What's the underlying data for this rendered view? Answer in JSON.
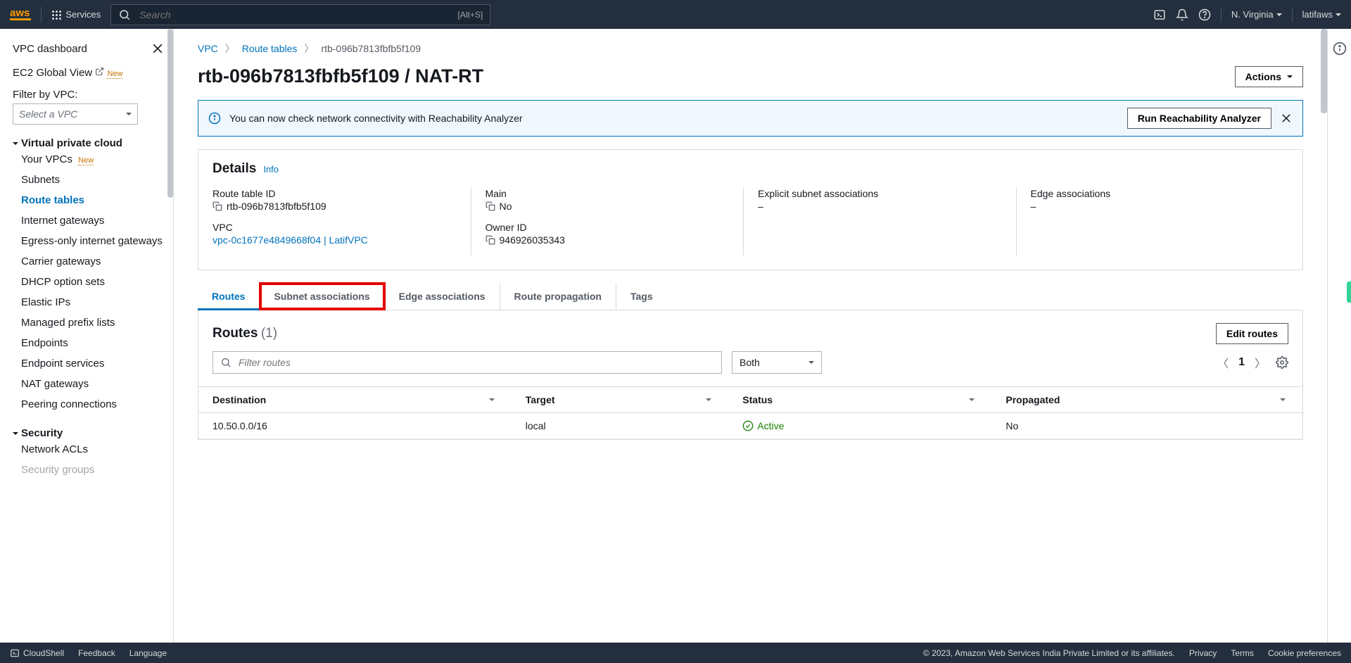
{
  "header": {
    "services": "Services",
    "search_placeholder": "Search",
    "search_shortcut": "[Alt+S]",
    "region": "N. Virginia",
    "user": "latifaws"
  },
  "sidebar": {
    "dashboard": "VPC dashboard",
    "ec2_global": "EC2 Global View",
    "new_badge": "New",
    "filter_label": "Filter by VPC:",
    "select_placeholder": "Select a VPC",
    "sections": [
      {
        "title": "Virtual private cloud",
        "items": [
          {
            "label": "Your VPCs",
            "new": true,
            "active": false
          },
          {
            "label": "Subnets"
          },
          {
            "label": "Route tables",
            "active": true
          },
          {
            "label": "Internet gateways"
          },
          {
            "label": "Egress-only internet gateways"
          },
          {
            "label": "Carrier gateways"
          },
          {
            "label": "DHCP option sets"
          },
          {
            "label": "Elastic IPs"
          },
          {
            "label": "Managed prefix lists"
          },
          {
            "label": "Endpoints"
          },
          {
            "label": "Endpoint services"
          },
          {
            "label": "NAT gateways"
          },
          {
            "label": "Peering connections"
          }
        ]
      },
      {
        "title": "Security",
        "items": [
          {
            "label": "Network ACLs"
          },
          {
            "label": "Security groups"
          }
        ]
      }
    ]
  },
  "breadcrumbs": {
    "vpc": "VPC",
    "route_tables": "Route tables",
    "current": "rtb-096b7813fbfb5f109"
  },
  "page_title": "rtb-096b7813fbfb5f109 / NAT-RT",
  "actions_label": "Actions",
  "banner": {
    "text": "You can now check network connectivity with Reachability Analyzer",
    "button": "Run Reachability Analyzer"
  },
  "details": {
    "title": "Details",
    "info": "Info",
    "route_table_id": {
      "label": "Route table ID",
      "value": "rtb-096b7813fbfb5f109"
    },
    "main": {
      "label": "Main",
      "value": "No"
    },
    "explicit_subnet": {
      "label": "Explicit subnet associations",
      "value": "–"
    },
    "edge_assoc": {
      "label": "Edge associations",
      "value": "–"
    },
    "vpc": {
      "label": "VPC",
      "value": "vpc-0c1677e4849668f04 | LatifVPC"
    },
    "owner_id": {
      "label": "Owner ID",
      "value": "946926035343"
    }
  },
  "tabs": [
    {
      "label": "Routes",
      "active": true
    },
    {
      "label": "Subnet associations",
      "highlight": true
    },
    {
      "label": "Edge associations"
    },
    {
      "label": "Route propagation"
    },
    {
      "label": "Tags"
    }
  ],
  "routes": {
    "title": "Routes",
    "count": "(1)",
    "edit_button": "Edit routes",
    "filter_placeholder": "Filter routes",
    "both_label": "Both",
    "page_num": "1",
    "columns": {
      "dest": "Destination",
      "target": "Target",
      "status": "Status",
      "prop": "Propagated"
    },
    "rows": [
      {
        "dest": "10.50.0.0/16",
        "target": "local",
        "status": "Active",
        "prop": "No"
      }
    ]
  },
  "footer": {
    "cloudshell": "CloudShell",
    "feedback": "Feedback",
    "language": "Language",
    "copyright": "© 2023, Amazon Web Services India Private Limited or its affiliates.",
    "privacy": "Privacy",
    "terms": "Terms",
    "cookie": "Cookie preferences"
  }
}
